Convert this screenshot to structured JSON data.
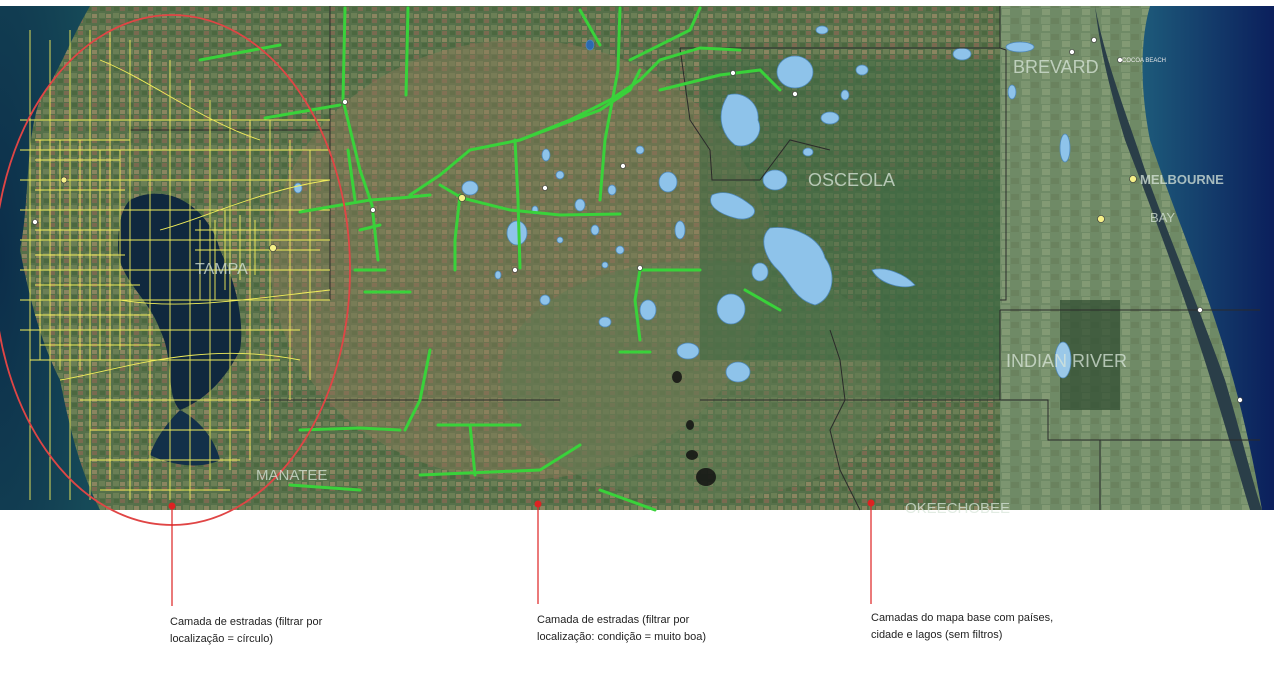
{
  "map": {
    "county_labels": [
      {
        "id": "brevard",
        "text": "BREVARD"
      },
      {
        "id": "osceola",
        "text": "OSCEOLA"
      },
      {
        "id": "melbourne",
        "text": "MELBOURNE"
      },
      {
        "id": "indian-river",
        "text": "INDIAN RIVER"
      },
      {
        "id": "tampa",
        "text": "TAMPA"
      },
      {
        "id": "okeechobee",
        "text": "OKEECHOBEE"
      },
      {
        "id": "manatee",
        "text": "MANATEE"
      },
      {
        "id": "bay",
        "text": "BAY"
      },
      {
        "id": "cocoa-beach",
        "text": "COCOA BEACH"
      }
    ],
    "colors": {
      "filtered_circle_roads": "#f2ee5a",
      "filtered_condition_roads": "#39d23a",
      "lakes": "#8ec3ea",
      "circle_outline": "#e04545",
      "callout_line": "#dd2222",
      "county_border": "#2a2a2a"
    }
  },
  "annotations": [
    {
      "id": "roads-circle",
      "text": "Camada de estradas (filtrar por localização = círculo)"
    },
    {
      "id": "roads-condition",
      "text": "Camada de estradas (filtrar por localização: condição = muito boa)"
    },
    {
      "id": "basemap",
      "text": "Camadas do mapa base com países, cidade e lagos (sem filtros)"
    }
  ]
}
